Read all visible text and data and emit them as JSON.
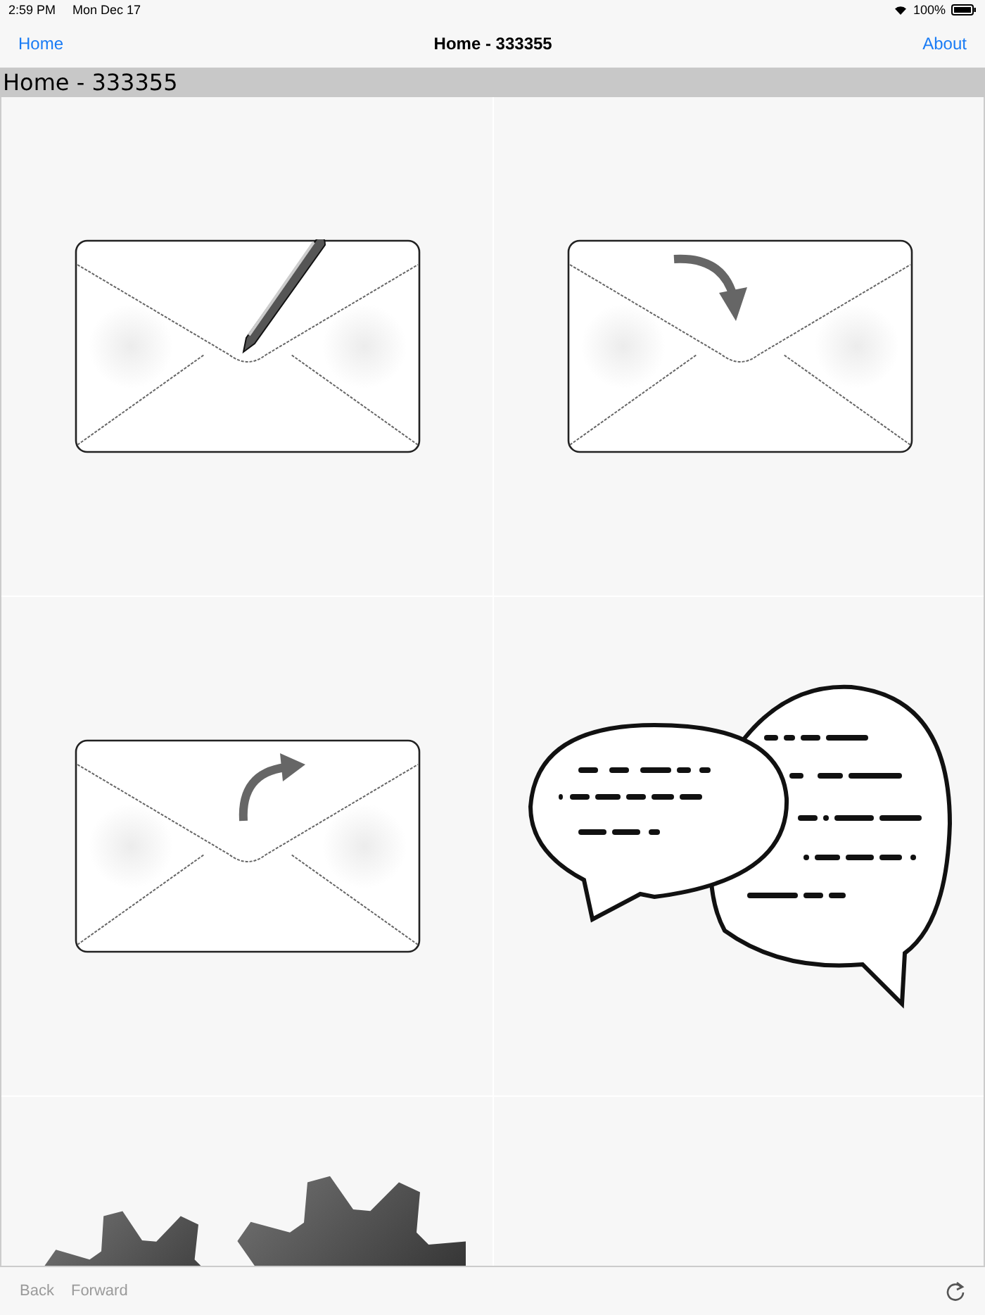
{
  "status_bar": {
    "time": "2:59 PM",
    "date": "Mon Dec 17",
    "battery": "100%"
  },
  "nav_bar": {
    "left": "Home",
    "title": "Home - 333355",
    "right": "About"
  },
  "header": "Home - 333355",
  "tiles": [
    {
      "kind": "compose"
    },
    {
      "kind": "reply"
    },
    {
      "kind": "forward"
    },
    {
      "kind": "chat"
    },
    {
      "kind": "settings"
    },
    {
      "kind": "empty"
    }
  ],
  "toolbar": {
    "back": {
      "label": "Back",
      "disabled": true
    },
    "forward": {
      "label": "Forward",
      "disabled": true
    }
  }
}
